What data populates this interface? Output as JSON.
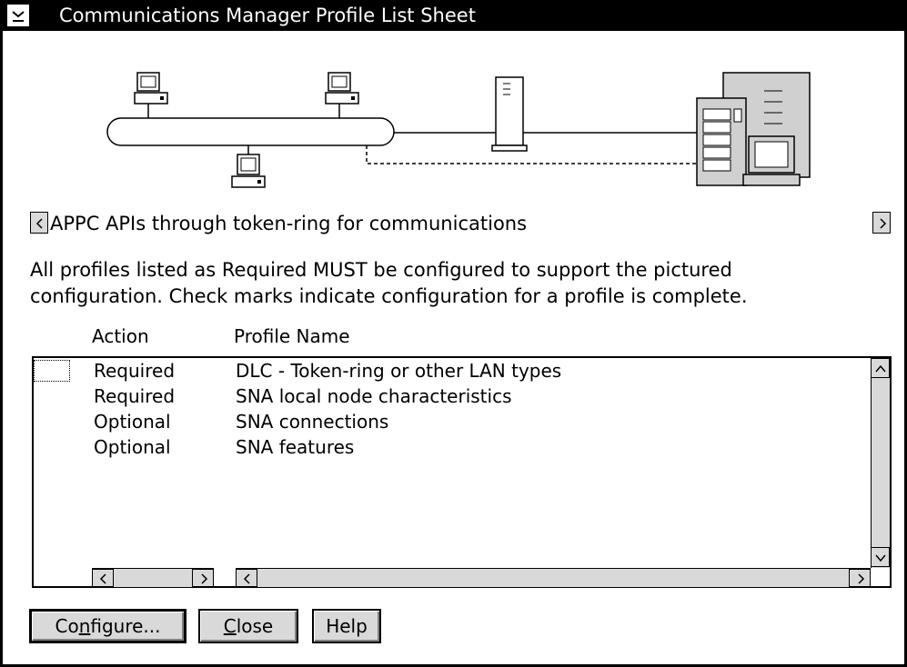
{
  "window": {
    "title": "Communications Manager Profile List Sheet"
  },
  "icons": {
    "system_menu": "system-menu-icon",
    "scroll_left": "scroll-left-arrow-icon",
    "scroll_right": "scroll-right-arrow-icon",
    "scroll_up": "scroll-up-arrow-icon",
    "scroll_down": "scroll-down-arrow-icon"
  },
  "configuration": {
    "title": "APPC APIs through token-ring for communications"
  },
  "instructions": {
    "line1": "All profiles listed as Required MUST be configured to support the pictured",
    "line2": "configuration. Check marks indicate configuration for a profile is complete."
  },
  "list": {
    "columns": {
      "action": "Action",
      "profile_name": "Profile Name"
    },
    "rows": [
      {
        "action": "Required",
        "profile": "DLC - Token-ring or other LAN types"
      },
      {
        "action": "Required",
        "profile": "SNA local node characteristics"
      },
      {
        "action": "Optional",
        "profile": "SNA connections"
      },
      {
        "action": "Optional",
        "profile": "SNA features"
      }
    ]
  },
  "buttons": {
    "configure_pre": "Co",
    "configure_mn": "n",
    "configure_post": "figure...",
    "close_mn": "C",
    "close_post": "lose",
    "help": "Help"
  },
  "colors": {
    "title_bar": "#000000",
    "button_face": "#d9d9d9",
    "window_bg": "#ffffff"
  }
}
